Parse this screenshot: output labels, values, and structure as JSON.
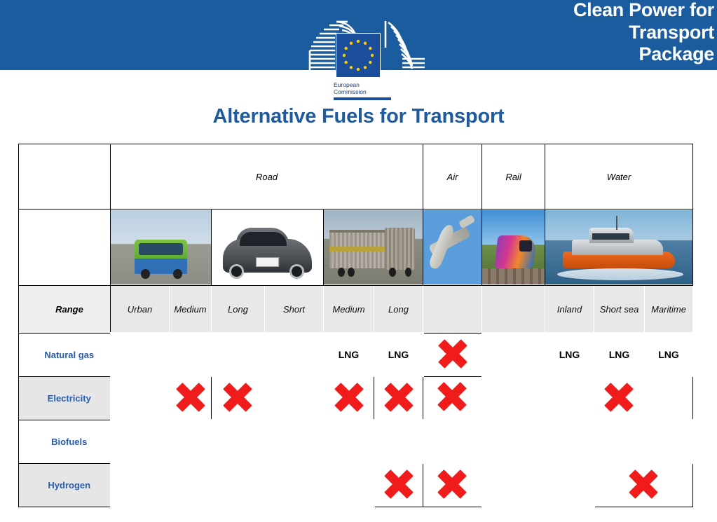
{
  "banner": {
    "title": "Clean Power for\nTransport\nPackage",
    "background_color": "#1b5c9e",
    "text_color": "#ffffff"
  },
  "logo": {
    "line1": "European",
    "line2": "Commission",
    "full_text": "European\nCommission",
    "flag_color": "#1b4e9b",
    "star_color": "#ffcc00"
  },
  "page_title": {
    "text": "Alternative Fuels for Transport",
    "color": "#1f5a9c"
  },
  "colors": {
    "available_green": "#0aa14b",
    "not_available_red": "#f01c1c",
    "header_grey": "#e8e8e8",
    "fuel_label_blue": "#2a5ca8"
  },
  "table": {
    "mode_headers": [
      {
        "label": "",
        "span": 1
      },
      {
        "label": "Road",
        "span": 6
      },
      {
        "label": "Air",
        "span": 1
      },
      {
        "label": "Rail",
        "span": 1
      },
      {
        "label": "Water",
        "span": 3
      }
    ],
    "image_row": {
      "label": "",
      "images": [
        {
          "name": "bus-photo",
          "alt": "city bus",
          "span": 2
        },
        {
          "name": "car-photo",
          "alt": "passenger car",
          "span": 2
        },
        {
          "name": "truck-photo",
          "alt": "articulated truck",
          "span": 2
        },
        {
          "name": "plane-photo",
          "alt": "airplane",
          "span": 1
        },
        {
          "name": "train-photo",
          "alt": "passenger train",
          "span": 1
        },
        {
          "name": "boat-photo",
          "alt": "rescue boat",
          "span": 3
        }
      ]
    },
    "range_row": {
      "label": "Range",
      "cells": [
        "Urban",
        "Medium",
        "Long",
        "Short",
        "Medium",
        "Long",
        "",
        "",
        "Inland",
        "Short sea",
        "Maritime"
      ]
    },
    "fuel_rows": [
      {
        "label": "Natural gas",
        "cells": [
          {
            "state": "yes",
            "text": ""
          },
          {
            "state": "yes",
            "text": ""
          },
          {
            "state": "yes",
            "text": ""
          },
          {
            "state": "yes",
            "text": ""
          },
          {
            "state": "yes",
            "text": "LNG"
          },
          {
            "state": "yes",
            "text": "LNG"
          },
          {
            "state": "no",
            "text": ""
          },
          {
            "state": "yes",
            "text": ""
          },
          {
            "state": "yes",
            "text": "LNG"
          },
          {
            "state": "yes",
            "text": "LNG"
          },
          {
            "state": "yes",
            "text": "LNG"
          }
        ]
      },
      {
        "label": "Electricity",
        "cells": [
          {
            "state": "yes",
            "text": ""
          },
          {
            "state": "no",
            "text": ""
          },
          {
            "state": "no",
            "text": ""
          },
          {
            "state": "yes",
            "text": ""
          },
          {
            "state": "no",
            "text": ""
          },
          {
            "state": "no",
            "text": ""
          },
          {
            "state": "no",
            "text": ""
          },
          {
            "state": "yes",
            "text": ""
          },
          {
            "state": "no",
            "text": "",
            "span": 3
          }
        ]
      },
      {
        "label": "Biofuels",
        "cells": [
          {
            "state": "yes",
            "text": ""
          },
          {
            "state": "yes",
            "text": ""
          },
          {
            "state": "yes",
            "text": ""
          },
          {
            "state": "yes",
            "text": ""
          },
          {
            "state": "yes",
            "text": ""
          },
          {
            "state": "yes",
            "text": ""
          },
          {
            "state": "yes",
            "text": ""
          },
          {
            "state": "yes",
            "text": ""
          },
          {
            "state": "yes",
            "text": ""
          },
          {
            "state": "yes",
            "text": ""
          },
          {
            "state": "yes",
            "text": ""
          }
        ]
      },
      {
        "label": "Hydrogen",
        "cells": [
          {
            "state": "yes",
            "text": ""
          },
          {
            "state": "yes",
            "text": ""
          },
          {
            "state": "yes",
            "text": ""
          },
          {
            "state": "yes",
            "text": ""
          },
          {
            "state": "yes",
            "text": ""
          },
          {
            "state": "no",
            "text": ""
          },
          {
            "state": "no",
            "text": ""
          },
          {
            "state": "yes",
            "text": ""
          },
          {
            "state": "yes",
            "text": ""
          },
          {
            "state": "no",
            "text": "",
            "span": 2
          }
        ]
      }
    ]
  }
}
